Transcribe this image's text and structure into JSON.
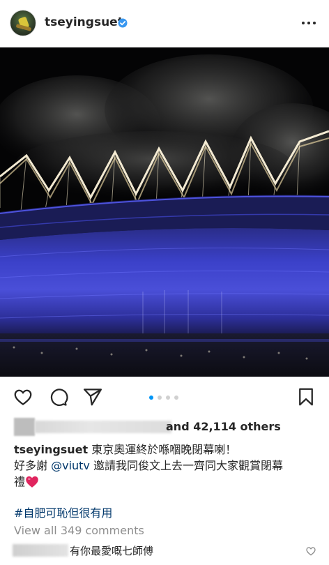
{
  "post": {
    "username": "tseyingsuet",
    "likes_text": "and 42,114 others",
    "caption_username": "tseyingsuet",
    "caption_line1": " 東京奧運終於喺嗰晚閉幕喇！",
    "caption_line2a": "好多謝 ",
    "mention": "@viutv",
    "caption_line2b": " 邀請我同俊文上去一齊同大家觀賞閉幕",
    "caption_line3": "禮",
    "hashtag": "#自肥可恥但很有用",
    "view_all_comments": "View all 349 comments",
    "comment_text": "有你最愛嘅七師傅"
  },
  "carousel": {
    "count": 4,
    "active_index": 0
  },
  "colors": {
    "verified": "#3897f0",
    "carousel_active": "#0095f6",
    "heart": "#ed4956",
    "link": "#00376b"
  },
  "icons": [
    "verified-badge-icon",
    "more-options-icon",
    "heart-icon",
    "comment-icon",
    "share-icon",
    "bookmark-icon",
    "heart-emoji-icon",
    "comment-like-icon"
  ]
}
